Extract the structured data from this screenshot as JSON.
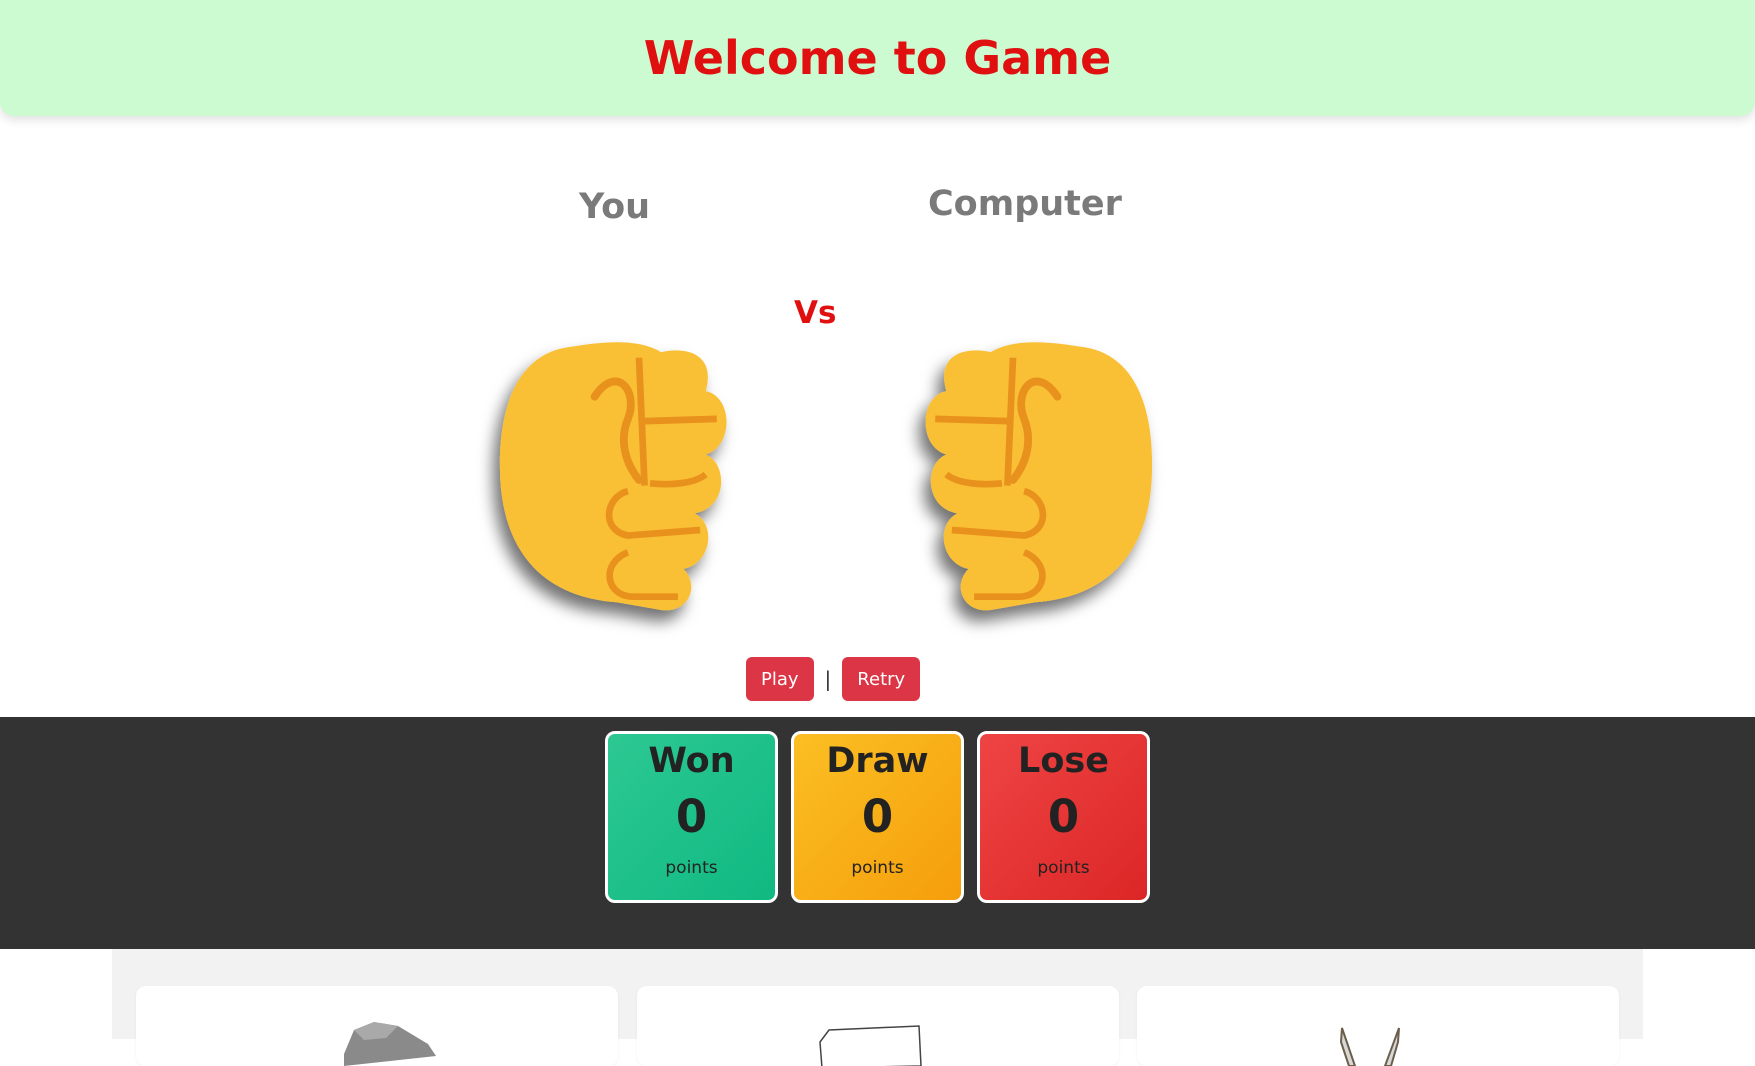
{
  "header": {
    "title": "Welcome to Game"
  },
  "players": {
    "you": "You",
    "computer": "Computer",
    "vs": "Vs"
  },
  "player_choice_icon": "fist-icon",
  "computer_choice_icon": "fist-icon",
  "controls": {
    "play": "Play",
    "separator": "|",
    "retry": "Retry"
  },
  "scores": {
    "won": {
      "label": "Won",
      "value": "0",
      "unit": "points",
      "color": "#10b981"
    },
    "draw": {
      "label": "Draw",
      "value": "0",
      "unit": "points",
      "color": "#f59e0b"
    },
    "lose": {
      "label": "Lose",
      "value": "0",
      "unit": "points",
      "color": "#dc2626"
    }
  },
  "choices": [
    {
      "icon": "rock-icon"
    },
    {
      "icon": "paper-icon"
    },
    {
      "icon": "scissors-icon"
    }
  ],
  "colors": {
    "header_bg": "#ccfbd1",
    "title": "#e01010",
    "button": "#dc3545",
    "scoreboard_bg": "#333333"
  }
}
